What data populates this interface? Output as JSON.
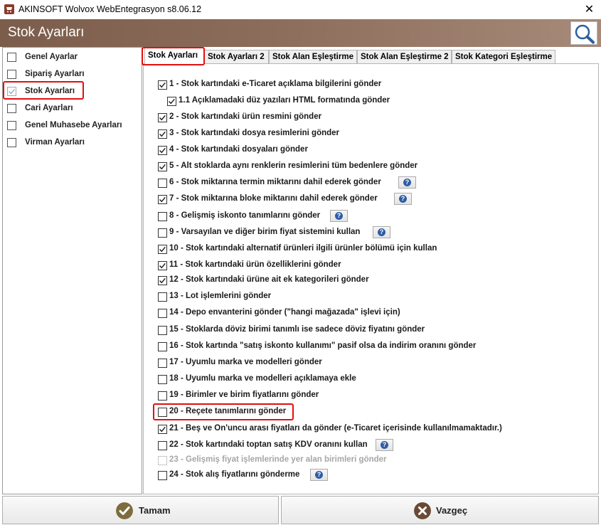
{
  "window": {
    "title": "AKINSOFT Wolvox WebEntegrasyon s8.06.12",
    "close_glyph": "✕"
  },
  "header": {
    "title": "Stok Ayarları",
    "search_icon": "magnifier-icon"
  },
  "sidebar": {
    "items": [
      {
        "label": "Genel Ayarlar",
        "checked": false
      },
      {
        "label": "Sipariş Ayarları",
        "checked": false
      },
      {
        "label": "Stok Ayarları",
        "checked": true,
        "selected": true
      },
      {
        "label": "Cari Ayarları",
        "checked": false
      },
      {
        "label": "Genel Muhasebe Ayarları",
        "checked": false
      },
      {
        "label": "Virman Ayarları",
        "checked": false
      }
    ]
  },
  "tabs": [
    {
      "label": "Stok Ayarları",
      "active": true
    },
    {
      "label": "Stok Ayarları 2",
      "active": false
    },
    {
      "label": "Stok Alan Eşleştirme",
      "active": false
    },
    {
      "label": "Stok Alan Eşleştirme 2",
      "active": false
    },
    {
      "label": "Stok Kategori Eşleştirme",
      "active": false
    }
  ],
  "options": [
    {
      "label": "1 - Stok kartındaki e-Ticaret açıklama bilgilerini gönder",
      "checked": true,
      "help": false
    },
    {
      "label": "1.1 Açıklamadaki düz yazıları HTML formatında gönder",
      "checked": true,
      "help": false,
      "indent": true
    },
    {
      "label": "2 - Stok kartındaki ürün resmini gönder",
      "checked": true,
      "help": false
    },
    {
      "label": "3 - Stok kartındaki dosya resimlerini gönder",
      "checked": true,
      "help": false
    },
    {
      "label": "4 - Stok kartındaki dosyaları gönder",
      "checked": true,
      "help": false
    },
    {
      "label": "5 - Alt stoklarda aynı renklerin resimlerini tüm bedenlere gönder",
      "checked": true,
      "help": false
    },
    {
      "label": "6 - Stok miktarına termin miktarını dahil ederek gönder",
      "checked": false,
      "help": true
    },
    {
      "label": "7 - Stok miktarına bloke miktarını dahil ederek gönder",
      "checked": true,
      "help": true
    },
    {
      "label": "8 - Gelişmiş iskonto tanımlarını gönder",
      "checked": false,
      "help": true
    },
    {
      "label": "9 - Varsayılan ve diğer birim fiyat sistemini kullan",
      "checked": false,
      "help": true
    },
    {
      "label": "10 - Stok kartındaki alternatif ürünleri ilgili ürünler bölümü için kullan",
      "checked": true,
      "help": false
    },
    {
      "label": "11 - Stok kartındaki ürün özelliklerini gönder",
      "checked": true,
      "help": false
    },
    {
      "label": "12 - Stok kartındaki ürüne ait ek kategorileri gönder",
      "checked": true,
      "help": false
    },
    {
      "label": "13 - Lot işlemlerini gönder",
      "checked": false,
      "help": false
    },
    {
      "label": "14 - Depo envanterini gönder (\"hangi mağazada\" işlevi için)",
      "checked": false,
      "help": false
    },
    {
      "label": "15 - Stoklarda döviz birimi tanımlı ise sadece döviz fiyatını gönder",
      "checked": false,
      "help": false
    },
    {
      "label": "16 - Stok kartında \"satış iskonto kullanımı\" pasif olsa da indirim oranını gönder",
      "checked": false,
      "help": false
    },
    {
      "label": "17 - Uyumlu marka ve modelleri gönder",
      "checked": false,
      "help": false
    },
    {
      "label": "18 - Uyumlu marka ve modelleri açıklamaya ekle",
      "checked": false,
      "help": false
    },
    {
      "label": "19 - Birimler ve birim fiyatlarını gönder",
      "checked": false,
      "help": false
    },
    {
      "label": "20 - Reçete tanımlarını gönder",
      "checked": false,
      "help": false,
      "highlighted": true
    },
    {
      "label": "21 - Beş ve On'uncu arası fiyatları da gönder (e-Ticaret içerisinde kullanılmamaktadır.)",
      "checked": true,
      "help": false
    },
    {
      "label": "22 - Stok kartındaki toptan satış KDV oranını kullan",
      "checked": false,
      "help": true
    },
    {
      "label": "23 - Gelişmiş fiyat işlemlerinde yer alan birimleri gönder",
      "checked": false,
      "help": false,
      "disabled": true
    },
    {
      "label": "24 - Stok alış fiyatlarını gönderme",
      "checked": false,
      "help": true
    }
  ],
  "buttons": {
    "ok_label": "Tamam",
    "cancel_label": "Vazgeç"
  },
  "colors": {
    "header_brown": "#7c5d4c",
    "highlight_red": "#e01010",
    "ok_green": "#7a6a3a",
    "cancel_brown": "#6a4a35",
    "help_blue": "#2e5da8"
  }
}
